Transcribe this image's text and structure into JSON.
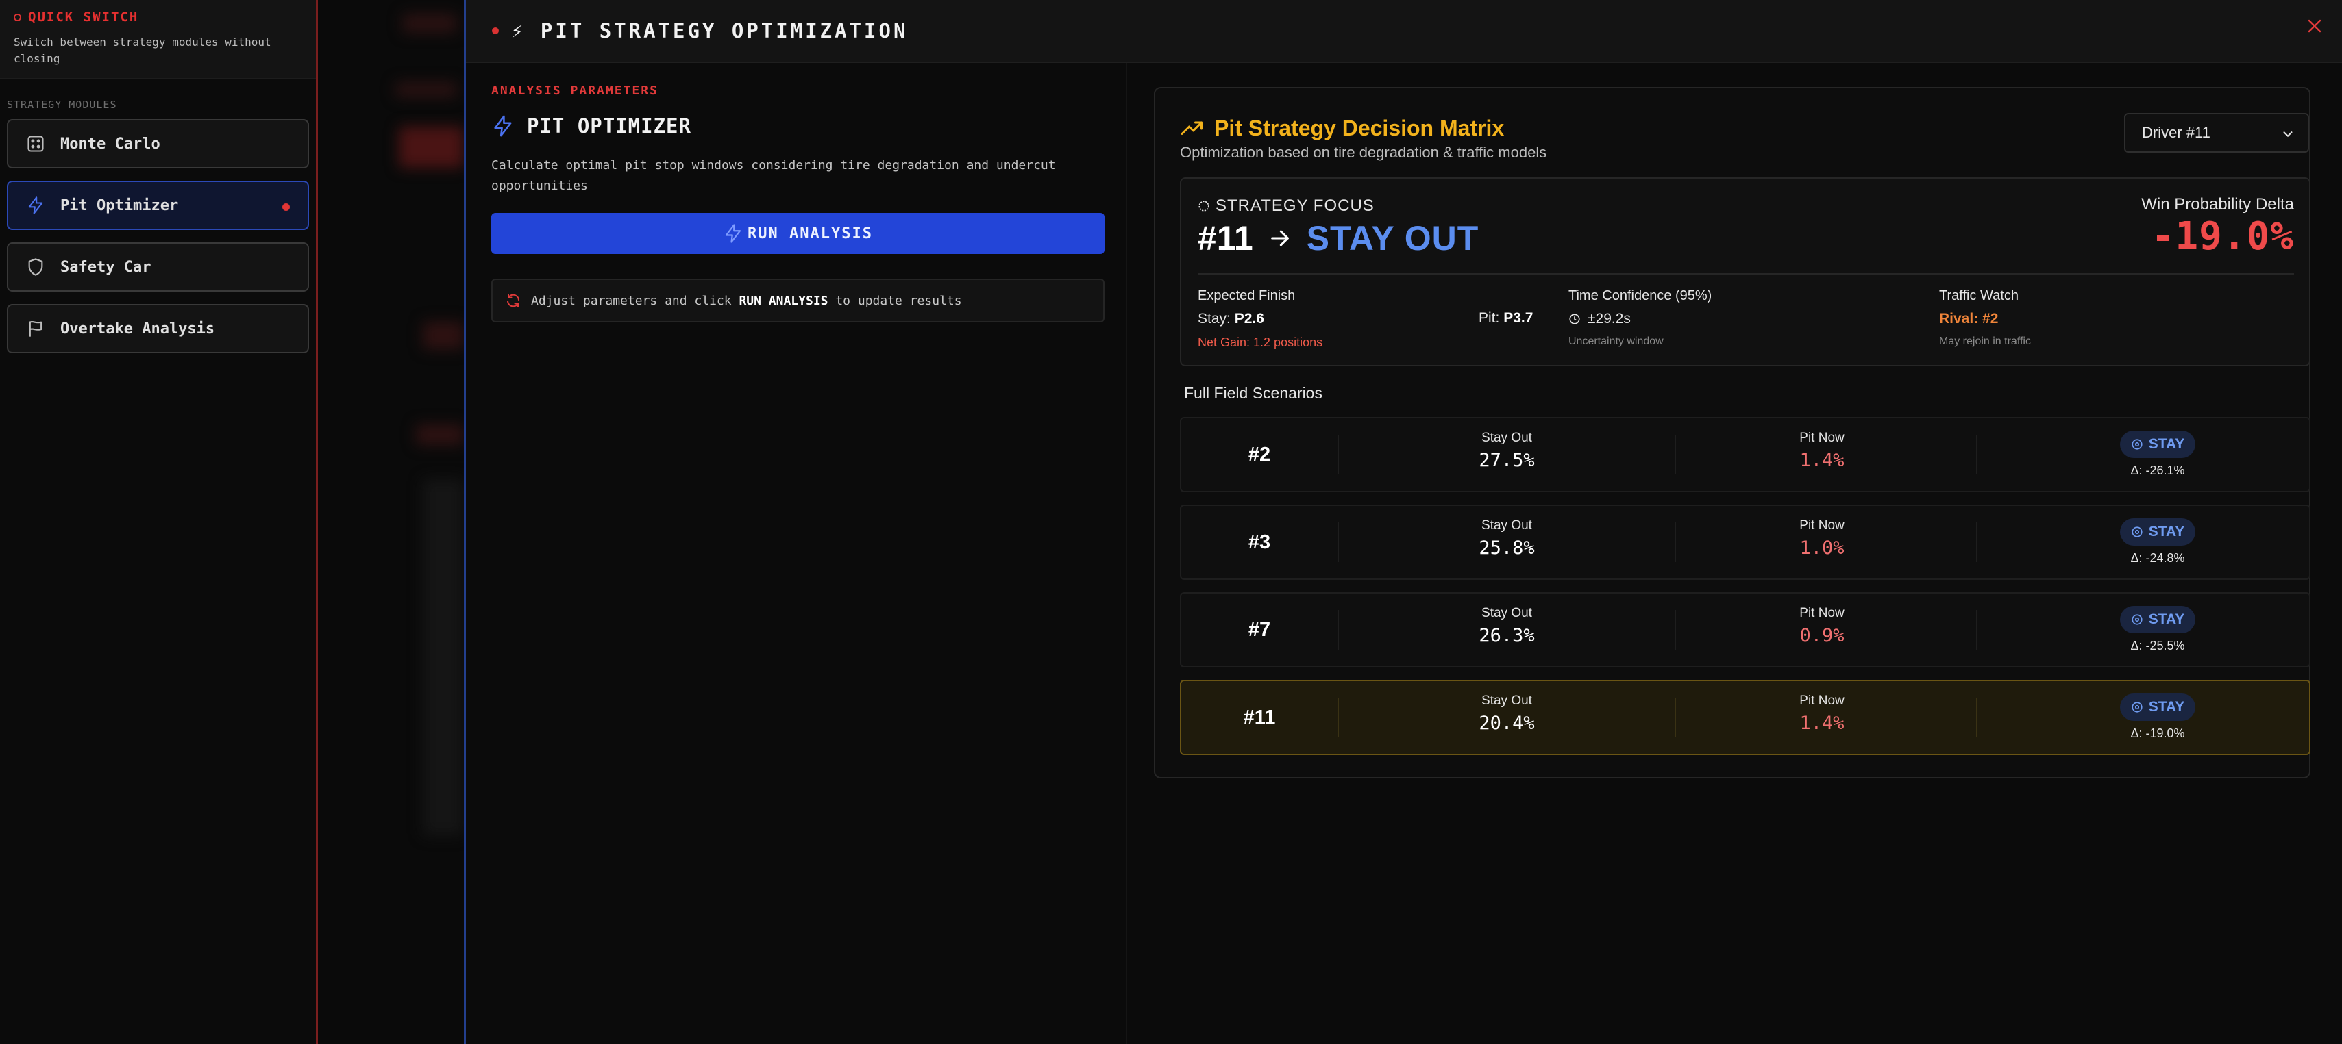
{
  "sidebar": {
    "title": "QUICK SWITCH",
    "subtitle": "Switch between strategy modules without closing",
    "section_label": "STRATEGY MODULES",
    "modules": [
      {
        "label": "Monte Carlo",
        "icon": "dice-icon",
        "active": false
      },
      {
        "label": "Pit Optimizer",
        "icon": "lightning-icon",
        "active": true
      },
      {
        "label": "Safety Car",
        "icon": "shield-icon",
        "active": false
      },
      {
        "label": "Overtake Analysis",
        "icon": "flag-icon",
        "active": false
      }
    ]
  },
  "header": {
    "title": "⚡ PIT STRATEGY OPTIMIZATION",
    "close_icon": "close-icon"
  },
  "params": {
    "section_label": "ANALYSIS PARAMETERS",
    "title": "PIT OPTIMIZER",
    "description": "Calculate optimal pit stop windows considering tire degradation and undercut opportunities",
    "run_button": "RUN ANALYSIS",
    "hint_prefix": "Adjust parameters and click",
    "hint_action": "RUN ANALYSIS",
    "hint_suffix": "to update results"
  },
  "matrix": {
    "title": "Pit Strategy Decision Matrix",
    "subtitle": "Optimization based on tire degradation & traffic models",
    "driver_select": "Driver #11",
    "focus": {
      "label": "STRATEGY FOCUS",
      "driver": "#11",
      "decision": "STAY OUT",
      "wpd_label": "Win Probability Delta",
      "wpd_value": "-19.0%",
      "expected_finish_label": "Expected Finish",
      "stay_prefix": "Stay:",
      "stay_value": "P2.6",
      "pit_prefix": "Pit:",
      "pit_value": "P3.7",
      "net_gain": "Net Gain: 1.2 positions",
      "confidence_label": "Time Confidence (95%)",
      "confidence_value": "±29.2s",
      "confidence_sub": "Uncertainty window",
      "traffic_label": "Traffic Watch",
      "traffic_value": "Rival: #2",
      "traffic_sub": "May rejoin in traffic"
    },
    "scenarios_title": "Full Field Scenarios",
    "col_stay": "Stay Out",
    "col_pit": "Pit Now",
    "scenarios": [
      {
        "driver": "#2",
        "stay": "27.5%",
        "pit": "1.4%",
        "rec": "STAY",
        "delta": "Δ: -26.1%",
        "highlight": false
      },
      {
        "driver": "#3",
        "stay": "25.8%",
        "pit": "1.0%",
        "rec": "STAY",
        "delta": "Δ: -24.8%",
        "highlight": false
      },
      {
        "driver": "#7",
        "stay": "26.3%",
        "pit": "0.9%",
        "rec": "STAY",
        "delta": "Δ: -25.5%",
        "highlight": false
      },
      {
        "driver": "#11",
        "stay": "20.4%",
        "pit": "1.4%",
        "rec": "STAY",
        "delta": "Δ: -19.0%",
        "highlight": true
      }
    ]
  },
  "colors": {
    "accent_red": "#e23a3a",
    "accent_blue": "#2345d8",
    "decision_blue": "#5b8def",
    "matrix_gold": "#f2b21c",
    "traffic_orange": "#f0853a"
  }
}
